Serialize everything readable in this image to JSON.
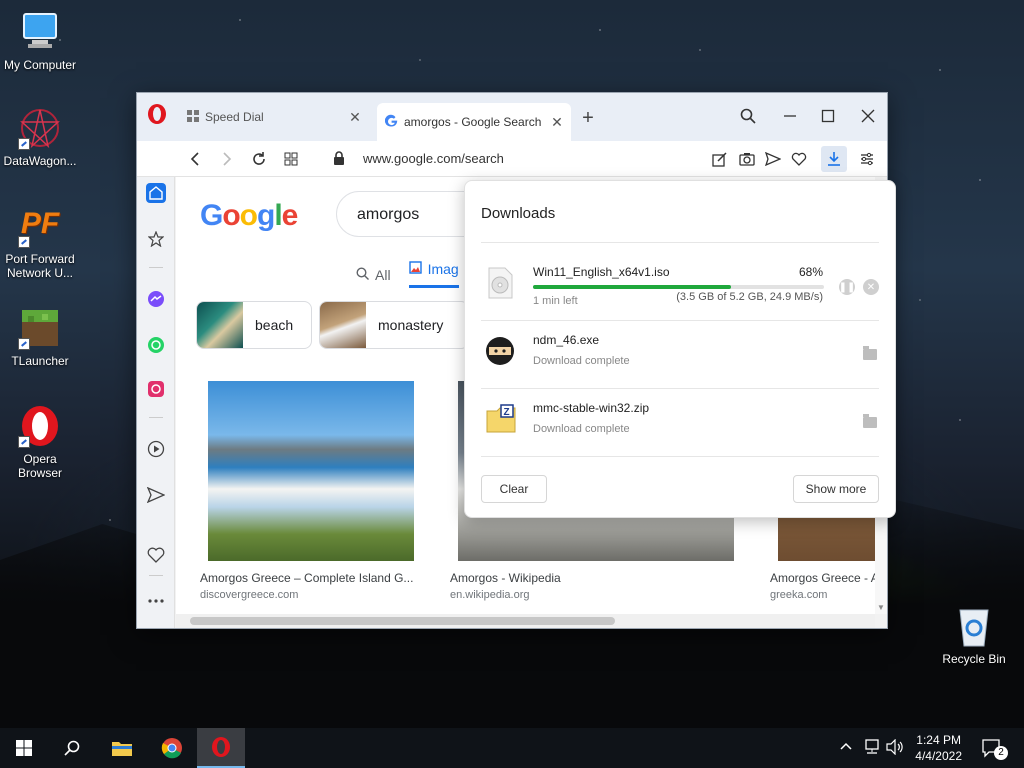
{
  "desktop": {
    "icons": [
      {
        "label": "My Computer"
      },
      {
        "label": "DataWagon..."
      },
      {
        "label": "Port Forward Network U..."
      },
      {
        "label": "TLauncher"
      },
      {
        "label": "Opera Browser"
      },
      {
        "label": "Recycle Bin"
      }
    ],
    "pf_glyph": "PF"
  },
  "browser": {
    "tabs": [
      {
        "title": "Speed Dial",
        "icon": "speed-dial-icon"
      },
      {
        "title": "amorgos - Google Search",
        "icon": "google-g-icon",
        "active": true
      }
    ],
    "new_tab_symbol": "+",
    "url": "www.google.com/search",
    "page": {
      "logo_letters": [
        "G",
        "o",
        "o",
        "g",
        "l",
        "e"
      ],
      "logo_colors": [
        "#4285F4",
        "#EA4335",
        "#FBBC05",
        "#4285F4",
        "#34A853",
        "#EA4335"
      ],
      "query": "amorgos",
      "tabs": [
        {
          "label": "All",
          "icon": "search-icon"
        },
        {
          "label": "Imag",
          "icon": "image-icon",
          "active": true
        }
      ],
      "chips": [
        {
          "label": "beach"
        },
        {
          "label": "monastery"
        }
      ],
      "results": [
        {
          "caption": "Amorgos Greece – Complete Island G...",
          "source": "discovergreece.com"
        },
        {
          "caption": "Amorgos - Wikipedia",
          "source": "en.wikipedia.org"
        },
        {
          "caption": "Amorgos Greece - A",
          "source": "greeka.com"
        }
      ]
    }
  },
  "downloads": {
    "title": "Downloads",
    "items": [
      {
        "name": "Win11_English_x64v1.iso",
        "status": "1 min left",
        "percent_label": "68%",
        "progress": 0.68,
        "detail": "(3.5 GB of 5.2 GB, 24.9 MB/s)"
      },
      {
        "name": "ndm_46.exe",
        "status": "Download complete"
      },
      {
        "name": "mmc-stable-win32.zip",
        "status": "Download complete"
      }
    ],
    "clear_label": "Clear",
    "show_more_label": "Show more"
  },
  "taskbar": {
    "time": "1:24 PM",
    "date": "4/4/2022",
    "notification_count": "2"
  }
}
